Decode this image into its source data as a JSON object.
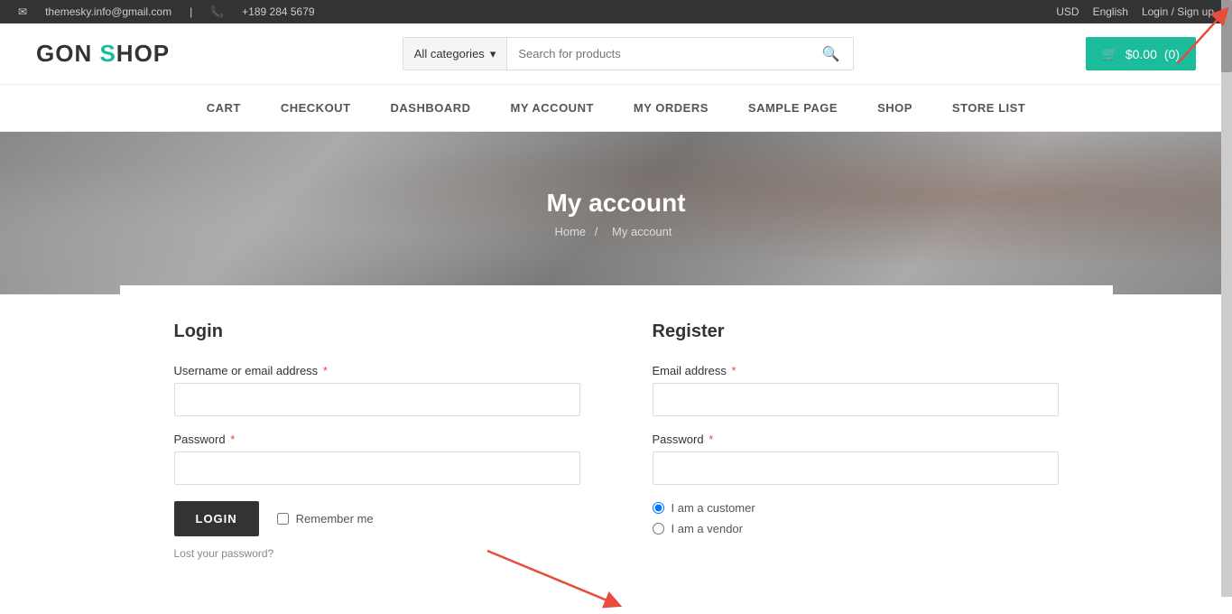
{
  "topbar": {
    "email": "themesky.info@gmail.com",
    "phone": "+189 284 5679",
    "currency": "USD",
    "language": "English",
    "login_label": "Login / Sign up"
  },
  "header": {
    "logo_text": "GON SHOP",
    "search_category": "All categories",
    "search_placeholder": "Search for products",
    "cart_amount": "$0.00",
    "cart_count": "(0)"
  },
  "nav": {
    "items": [
      {
        "label": "CART",
        "href": "#"
      },
      {
        "label": "CHECKOUT",
        "href": "#"
      },
      {
        "label": "DASHBOARD",
        "href": "#"
      },
      {
        "label": "MY ACCOUNT",
        "href": "#"
      },
      {
        "label": "MY ORDERS",
        "href": "#"
      },
      {
        "label": "SAMPLE PAGE",
        "href": "#"
      },
      {
        "label": "SHOP",
        "href": "#"
      },
      {
        "label": "STORE LIST",
        "href": "#"
      }
    ]
  },
  "hero": {
    "title": "My account",
    "breadcrumb_home": "Home",
    "breadcrumb_separator": "/",
    "breadcrumb_current": "My account"
  },
  "login_section": {
    "heading": "Login",
    "username_label": "Username or email address",
    "password_label": "Password",
    "login_button": "LOGIN",
    "remember_label": "Remember me",
    "lost_password": "Lost your password?"
  },
  "register_section": {
    "heading": "Register",
    "email_label": "Email address",
    "password_label": "Password",
    "role_customer": "I am a customer",
    "role_vendor": "I am a vendor"
  }
}
